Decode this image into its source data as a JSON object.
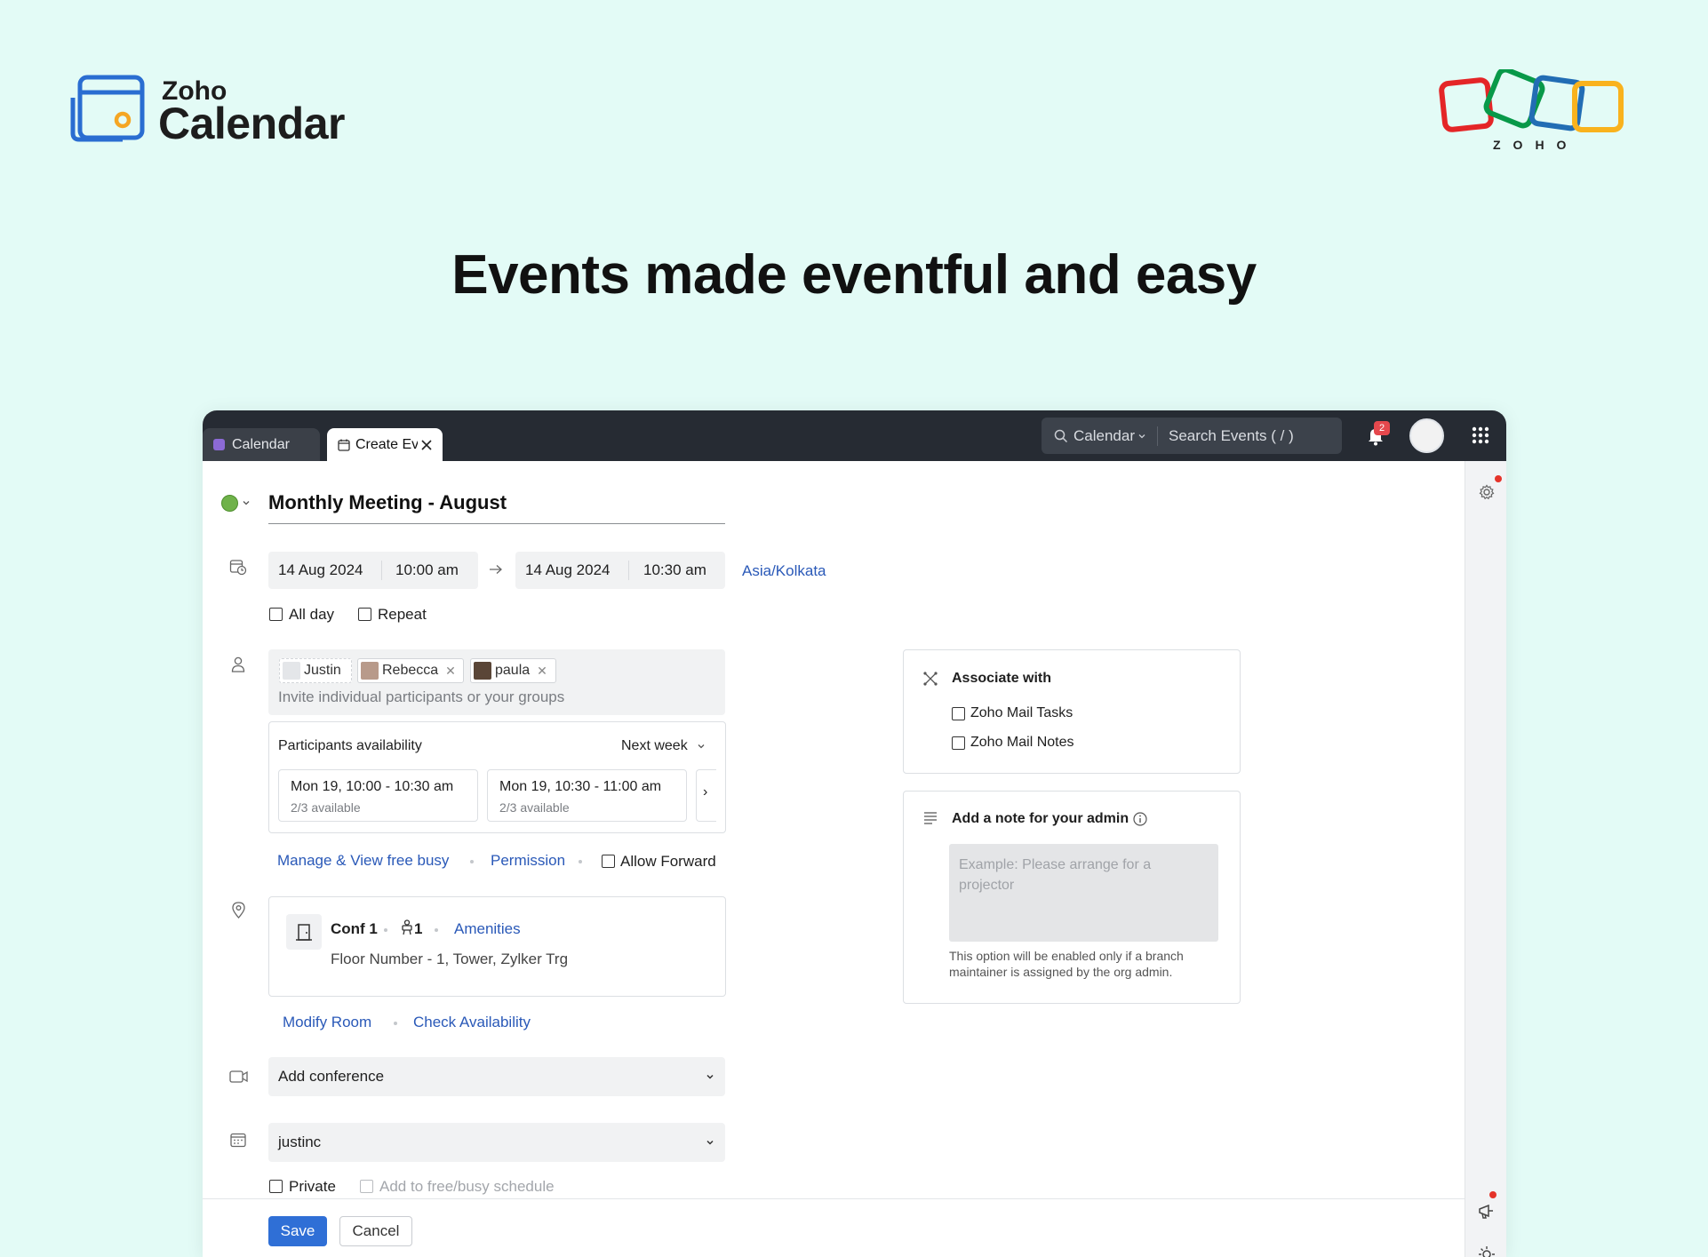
{
  "brand": {
    "zoho": "Zoho",
    "calendar": "Calendar",
    "zoho_logo_text": "ZOHO"
  },
  "headline": "Events made eventful and easy",
  "tabs": [
    {
      "label": "Calendar"
    },
    {
      "label": "Create Ev"
    }
  ],
  "topbar": {
    "search_scope": "Calendar",
    "search_placeholder": "Search Events ( / )",
    "notification_count": "2"
  },
  "event": {
    "color": "#6fb24a",
    "title": "Monthly Meeting - August",
    "start_date": "14 Aug 2024",
    "start_time": "10:00 am",
    "end_date": "14 Aug 2024",
    "end_time": "10:30 am",
    "timezone": "Asia/Kolkata",
    "all_day_label": "All day",
    "repeat_label": "Repeat"
  },
  "participants": {
    "chips": [
      "Justin",
      "Rebecca",
      "paula"
    ],
    "placeholder": "Invite individual participants or your groups",
    "availability_title": "Participants availability",
    "range": "Next week",
    "slots": [
      {
        "time": "Mon 19, 10:00 - 10:30 am",
        "avail": "2/3 available"
      },
      {
        "time": "Mon 19, 10:30 - 11:00 am",
        "avail": "2/3 available"
      }
    ],
    "manage_link": "Manage & View free busy",
    "permission_link": "Permission",
    "allow_forward": "Allow Forward"
  },
  "location": {
    "room": "Conf 1",
    "seats": "1",
    "amenities": "Amenities",
    "address": "Floor Number - 1, Tower, Zylker Trg",
    "modify": "Modify Room",
    "check": "Check Availability"
  },
  "conference": {
    "label": "Add conference"
  },
  "calendar_select": {
    "value": "justinc"
  },
  "privacy": {
    "private": "Private",
    "freebusy": "Add to free/busy schedule"
  },
  "actions": {
    "save": "Save",
    "cancel": "Cancel"
  },
  "associate": {
    "title": "Associate with",
    "options": [
      "Zoho Mail Tasks",
      "Zoho Mail Notes"
    ]
  },
  "admin_note": {
    "title": "Add a note for your admin",
    "placeholder": "Example: Please arrange for a projector",
    "help_line1": "This option will be enabled only if a branch",
    "help_line2": "maintainer is assigned by the org admin."
  }
}
